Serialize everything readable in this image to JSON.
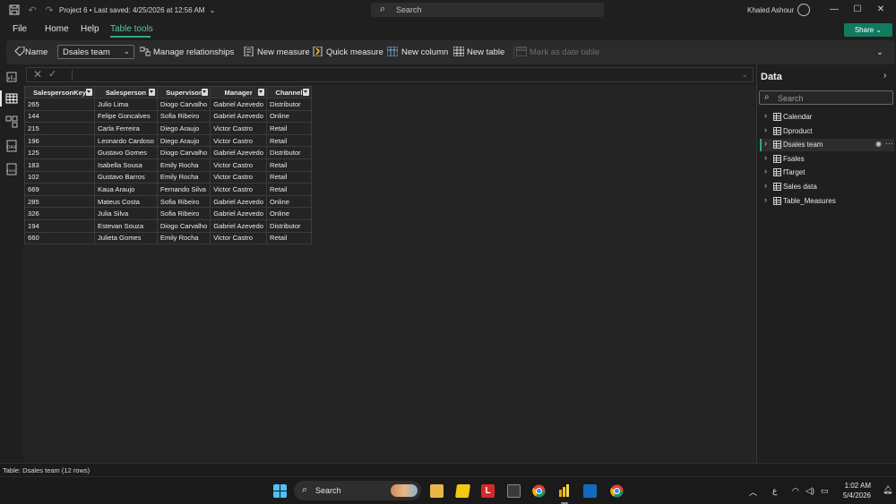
{
  "titlebar": {
    "title": "Project 6 • Last saved: 4/25/2026 at 12:56 AM",
    "search_placeholder": "Search",
    "user_name": "Khaled Ashour"
  },
  "menu": {
    "file": "File",
    "home": "Home",
    "help": "Help",
    "table_tools": "Table tools",
    "share": "Share"
  },
  "ribbon": {
    "name_label": "Name",
    "name_value": "Dsales team",
    "manage_relationships": "Manage relationships",
    "new_measure": "New measure",
    "quick_measure": "Quick measure",
    "new_column": "New column",
    "new_table": "New table",
    "mark_as_date_table": "Mark as date table"
  },
  "table": {
    "columns": [
      "SalespersonKey",
      "Salesperson",
      "Supervisor",
      "Manager",
      "Channel"
    ],
    "rows": [
      [
        "265",
        "Julio Lima",
        "Diogo Carvalho",
        "Gabriel Azevedo",
        "Distributor"
      ],
      [
        "144",
        "Felipe Goncalves",
        "Sofia Ribeiro",
        "Gabriel Azevedo",
        "Online"
      ],
      [
        "215",
        "Carla Ferreira",
        "Diego Araujo",
        "Victor Castro",
        "Retail"
      ],
      [
        "196",
        "Leonardo Cardoso",
        "Diego Araujo",
        "Victor Castro",
        "Retail"
      ],
      [
        "125",
        "Gustavo Gomes",
        "Diogo Carvalho",
        "Gabriel Azevedo",
        "Distributor"
      ],
      [
        "183",
        "Isabella Sousa",
        "Emily Rocha",
        "Victor Castro",
        "Retail"
      ],
      [
        "102",
        "Gustavo Barros",
        "Emily Rocha",
        "Victor Castro",
        "Retail"
      ],
      [
        "669",
        "Kaua Araujo",
        "Fernando Silva",
        "Victor Castro",
        "Retail"
      ],
      [
        "285",
        "Mateus Costa",
        "Sofia Ribeiro",
        "Gabriel Azevedo",
        "Online"
      ],
      [
        "326",
        "Julia Silva",
        "Sofia Ribeiro",
        "Gabriel Azevedo",
        "Online"
      ],
      [
        "194",
        "Estevan Souza",
        "Diogo Carvalho",
        "Gabriel Azevedo",
        "Distributor"
      ],
      [
        "660",
        "Julieta Gomes",
        "Emily Rocha",
        "Victor Castro",
        "Retail"
      ]
    ]
  },
  "data_pane": {
    "title": "Data",
    "search_placeholder": "Search",
    "tables": [
      "Calendar",
      "Dproduct",
      "Dsales team",
      "Fsales",
      "fTarget",
      "Sales data",
      "Table_Measures"
    ],
    "selected": "Dsales team"
  },
  "status": {
    "text": "Table: Dsales team (12 rows)"
  },
  "taskbar": {
    "search_label": "Search",
    "time": "1:02 AM",
    "date": "5/4/2026",
    "lang": "ع"
  },
  "colors": {
    "accent": "#2fa887",
    "share_bg": "#127a5d",
    "background": "#1f1f1f"
  }
}
